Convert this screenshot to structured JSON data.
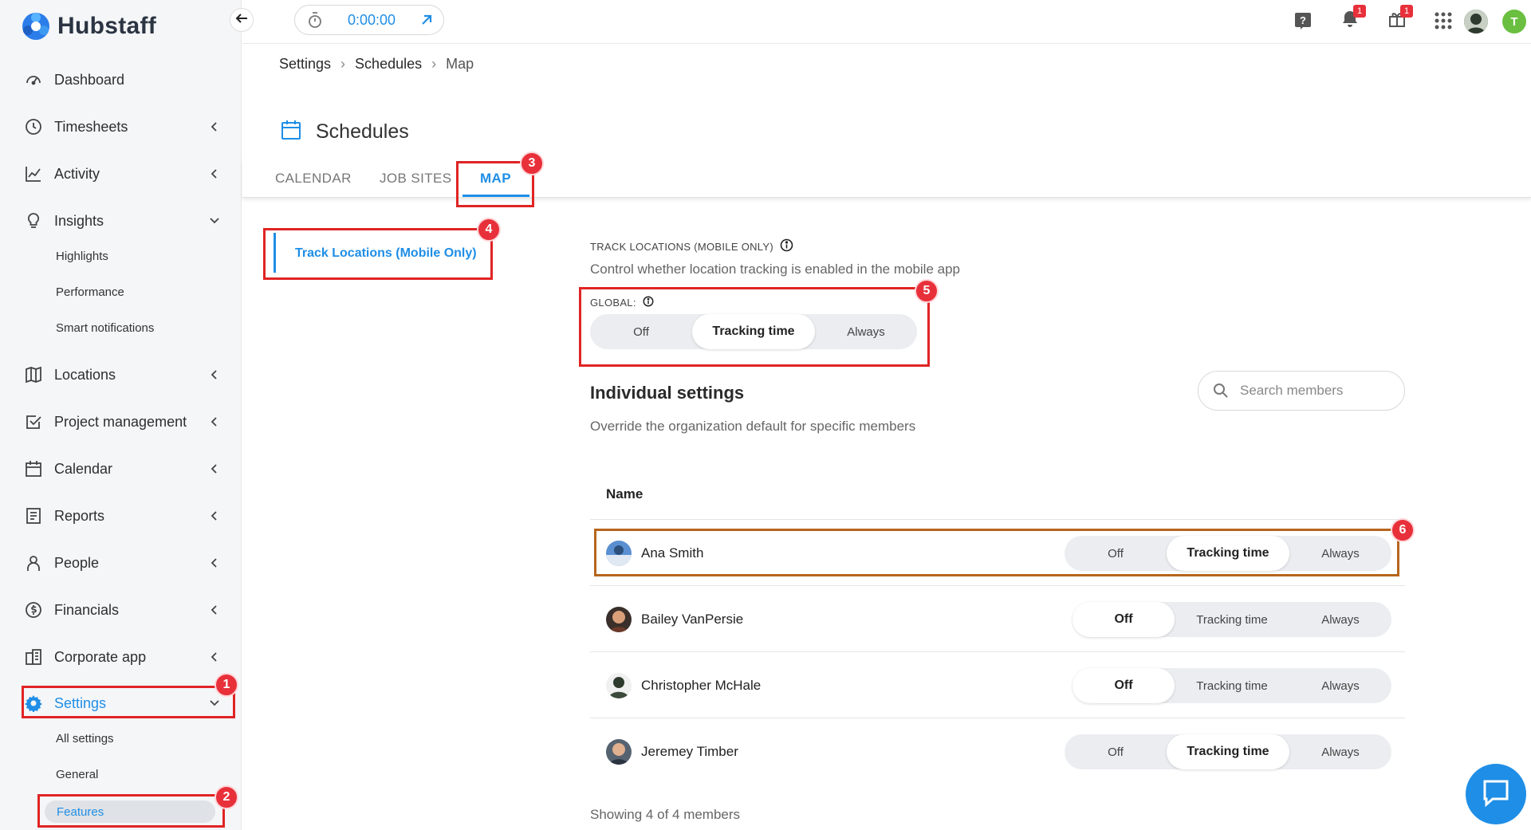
{
  "brand": {
    "name": "Hubstaff",
    "accent": "#1f8ee6"
  },
  "timer": {
    "value": "0:00:00"
  },
  "topbar": {
    "notifications_badge": "1",
    "gifts_badge": "1",
    "user_initial": "T"
  },
  "sidebar": {
    "items": [
      {
        "label": "Dashboard",
        "icon": "dashboard-icon"
      },
      {
        "label": "Timesheets",
        "icon": "clock-icon"
      },
      {
        "label": "Activity",
        "icon": "chart-icon"
      },
      {
        "label": "Insights",
        "icon": "lightbulb-icon"
      },
      {
        "label": "Locations",
        "icon": "map-icon"
      },
      {
        "label": "Project management",
        "icon": "checkbox-icon"
      },
      {
        "label": "Calendar",
        "icon": "calendar-icon"
      },
      {
        "label": "Reports",
        "icon": "report-icon"
      },
      {
        "label": "People",
        "icon": "person-icon"
      },
      {
        "label": "Financials",
        "icon": "dollar-icon"
      },
      {
        "label": "Corporate app",
        "icon": "building-icon"
      },
      {
        "label": "Settings",
        "icon": "gear-icon"
      }
    ],
    "insights_sub": [
      "Highlights",
      "Performance",
      "Smart notifications"
    ],
    "settings_sub": [
      "All settings",
      "General",
      "Features"
    ]
  },
  "breadcrumb": [
    "Settings",
    "Schedules",
    "Map"
  ],
  "page": {
    "title": "Schedules"
  },
  "tabs": [
    "CALENDAR",
    "JOB SITES",
    "MAP"
  ],
  "left_menu": {
    "label": "Track Locations (Mobile Only)"
  },
  "track": {
    "label": "TRACK LOCATIONS (MOBILE ONLY)",
    "desc": "Control whether location tracking is enabled in the mobile app",
    "global_label": "GLOBAL:",
    "options": [
      "Off",
      "Tracking time",
      "Always"
    ],
    "global_selected": "Tracking time"
  },
  "individual": {
    "title": "Individual settings",
    "desc": "Override the organization default for specific members",
    "search_placeholder": "Search members",
    "column_name": "Name",
    "members": [
      {
        "name": "Ana Smith",
        "setting": "Tracking time"
      },
      {
        "name": "Bailey VanPersie",
        "setting": "Off"
      },
      {
        "name": "Christopher McHale",
        "setting": "Off"
      },
      {
        "name": "Jeremey Timber",
        "setting": "Tracking time"
      }
    ],
    "footer": "Showing 4 of 4 members"
  },
  "annotations": [
    "1",
    "2",
    "3",
    "4",
    "5",
    "6"
  ]
}
